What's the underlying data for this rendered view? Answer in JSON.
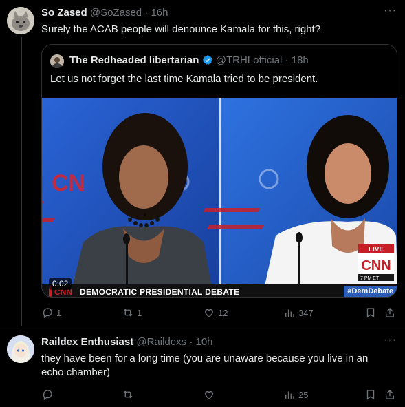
{
  "tweet1": {
    "name": "So Zased",
    "handle": "@SoZased",
    "time": "· 16h",
    "text": "Surely the ACAB people will denounce Kamala for this, right?",
    "quote": {
      "name": "The Redheaded libertarian",
      "handle": "@TRHLofficial",
      "time": "· 18h",
      "text": "Let us not forget the last time Kamala tried to be president.",
      "video": {
        "duration": "0:02",
        "banner": "DEMOCRATIC PRESIDENTIAL DEBATE",
        "hashtag": "#DemDebate",
        "live_label": "LIVE",
        "network": "CNN",
        "clock": "7 PM ET"
      }
    },
    "actions": {
      "replies": "1",
      "reposts": "1",
      "likes": "12",
      "views": "347"
    }
  },
  "tweet2": {
    "name": "Raildex Enthusiast",
    "handle": "@Raildexs",
    "time": "· 10h",
    "text": "they have been for a long time (you are unaware because you live in an echo chamber)",
    "actions": {
      "replies": "",
      "reposts": "",
      "likes": "",
      "views": "25"
    }
  },
  "colors": {
    "background": "#000000",
    "text": "#e7e9ea",
    "muted": "#71767b",
    "border": "#2f3336",
    "verified": "#1d9bf0"
  }
}
